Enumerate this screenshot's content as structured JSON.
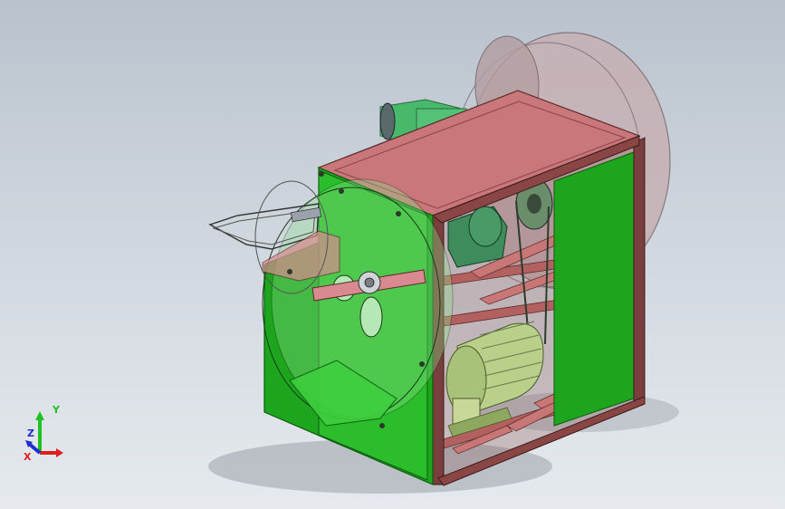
{
  "viewport": {
    "background_top": "#b9c2cd",
    "background_bottom": "#e6eaee"
  },
  "model": {
    "frame_color": "#7a3e3c",
    "top_plate_color": "#c9777a",
    "side_panel_color": "#1ea51e",
    "housing_color": "#3ecf3e",
    "motor_color": "#b9d08a",
    "gearbox_color": "#3e8c5c",
    "flywheel_color": "#c6b0b4"
  },
  "triad": {
    "x_label": "X",
    "y_label": "Y",
    "z_label": "Z",
    "x_color": "#e02020",
    "y_color": "#20c020",
    "z_color": "#2030d0"
  }
}
